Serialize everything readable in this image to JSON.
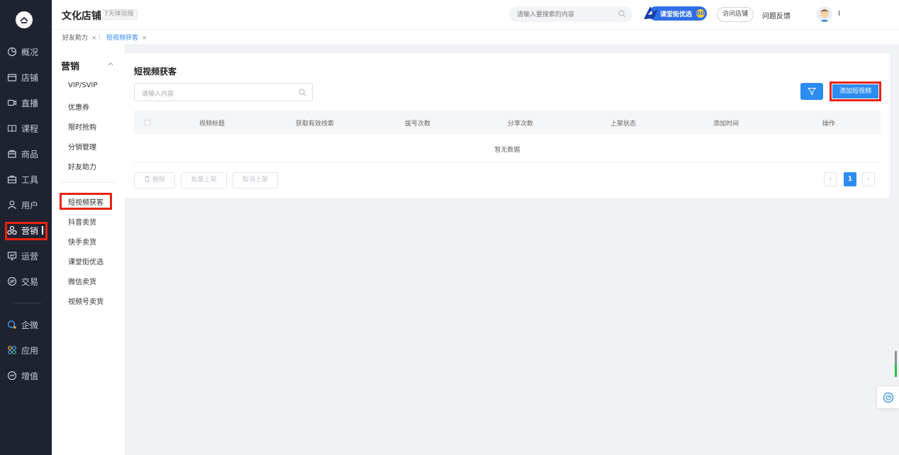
{
  "left_nav": {
    "items": [
      {
        "label": "概况",
        "icon": "overview-icon"
      },
      {
        "label": "店铺",
        "icon": "store-icon"
      },
      {
        "label": "直播",
        "icon": "live-icon"
      },
      {
        "label": "课程",
        "icon": "course-icon"
      },
      {
        "label": "商品",
        "icon": "goods-icon"
      },
      {
        "label": "工具",
        "icon": "tools-icon"
      },
      {
        "label": "用户",
        "icon": "user-icon"
      },
      {
        "label": "营销",
        "icon": "marketing-icon"
      },
      {
        "label": "运营",
        "icon": "operation-icon"
      },
      {
        "label": "交易",
        "icon": "trade-icon"
      },
      {
        "label": "企微",
        "icon": "wecom-icon"
      },
      {
        "label": "应用",
        "icon": "apps-icon"
      },
      {
        "label": "增值",
        "icon": "value-added-icon"
      }
    ],
    "active": "营销"
  },
  "header": {
    "shop_name": "文化店铺",
    "trial_badge": "7天体验版",
    "search_placeholder": "请输入要搜索的内容",
    "promo_text": "课堂街优选",
    "promo_coin": "GO",
    "visit_store": "访问店铺",
    "feedback": "问题反馈",
    "user_name": "I"
  },
  "tabs": [
    {
      "label": "好友助力",
      "close": "×",
      "active": false
    },
    {
      "label": "短视频获客",
      "close": "×",
      "active": true
    }
  ],
  "subnav": {
    "title": "营销",
    "group1": [
      "VIP/SVIP",
      "优惠券",
      "限时抢购",
      "分销管理",
      "好友助力"
    ],
    "group2": [
      "短视频获客",
      "抖音卖货",
      "快手卖货",
      "课堂街优选",
      "微信卖货",
      "视频号卖货"
    ],
    "active": "短视频获客"
  },
  "main": {
    "title": "短视频获客",
    "search_placeholder": "请输入内容",
    "add_button": "添加短视频",
    "columns": [
      "视频标题",
      "获取有效线索",
      "拔号次数",
      "分享次数",
      "上架状态",
      "添加时间",
      "操作"
    ],
    "empty_text": "暂无数据",
    "bulk_buttons": {
      "delete": "删除",
      "batch_list": "批量上架",
      "cancel_list": "取消上架"
    },
    "pagination": {
      "current": "1",
      "prev": "‹",
      "next": "›"
    }
  },
  "colors": {
    "primary": "#2d8cf0",
    "highlight": "#e8230f",
    "nav_bg": "#1f2330"
  }
}
